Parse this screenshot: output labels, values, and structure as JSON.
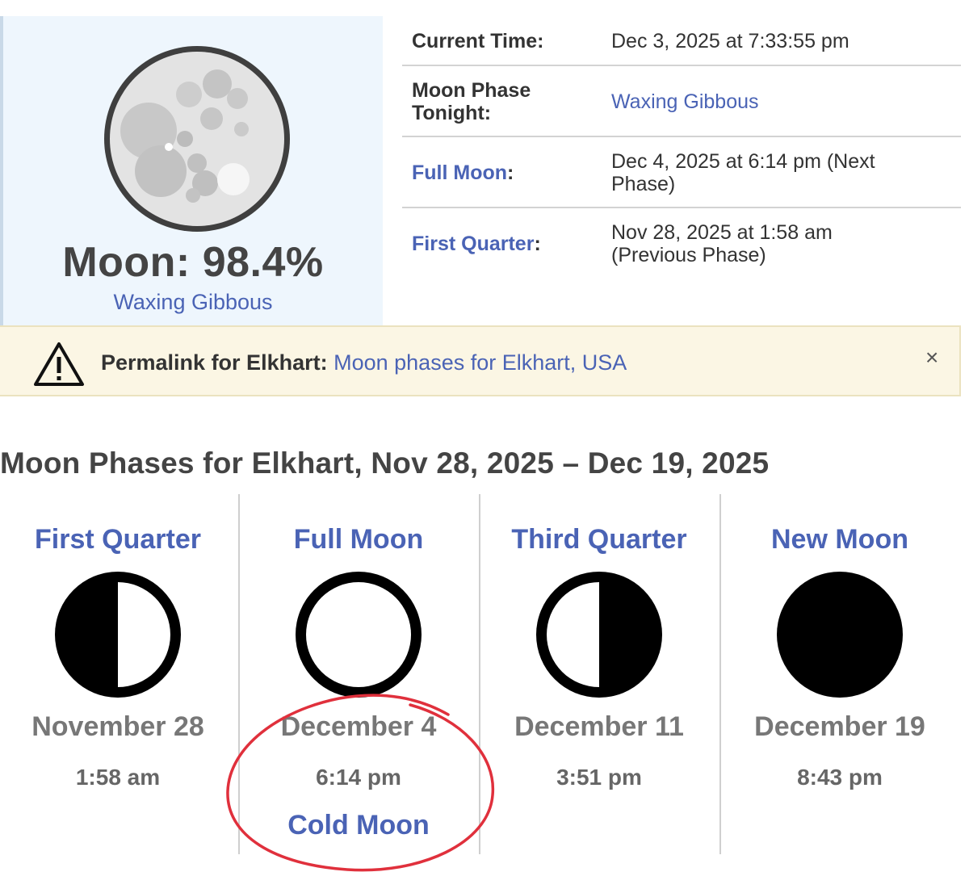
{
  "current": {
    "percent_text": "Moon: 98.4%",
    "illumination_percent": 98.4,
    "phase_name": "Waxing Gibbous",
    "icon": "moon-gibbous-icon"
  },
  "info": {
    "current_time_label": "Current Time:",
    "current_time_value": "Dec 3, 2025 at 7:33:55 pm",
    "tonight_label_line1": "Moon Phase",
    "tonight_label_line2": "Tonight:",
    "tonight_value": "Waxing Gibbous",
    "next_label": "Full Moon",
    "next_colon": ":",
    "next_value_line1": "Dec 4, 2025 at 6:14 pm (Next",
    "next_value_line2": "Phase)",
    "prev_label": "First Quarter",
    "prev_colon": ":",
    "prev_value_line1": "Nov 28, 2025 at 1:58 am",
    "prev_value_line2": "(Previous Phase)"
  },
  "permalink": {
    "icon": "warning-icon",
    "label": "Permalink for Elkhart:",
    "link_text": "Moon phases for Elkhart, USA",
    "close": "×"
  },
  "section": {
    "title": "Moon Phases for Elkhart, Nov 28, 2025 – Dec 19, 2025"
  },
  "phases": [
    {
      "name": "First Quarter",
      "icon": "first-quarter-moon-icon",
      "date": "November 28",
      "time": "1:58 am",
      "special": ""
    },
    {
      "name": "Full Moon",
      "icon": "full-moon-icon",
      "date": "December 4",
      "time": "6:14 pm",
      "special": "Cold Moon"
    },
    {
      "name": "Third Quarter",
      "icon": "third-quarter-moon-icon",
      "date": "December 11",
      "time": "3:51 pm",
      "special": ""
    },
    {
      "name": "New Moon",
      "icon": "new-moon-icon",
      "date": "December 19",
      "time": "8:43 pm",
      "special": ""
    }
  ],
  "colors": {
    "link": "#4a63b5",
    "card_bg": "#eef6fd",
    "alert_bg": "#fbf6e4",
    "annotation": "#e0303c"
  }
}
